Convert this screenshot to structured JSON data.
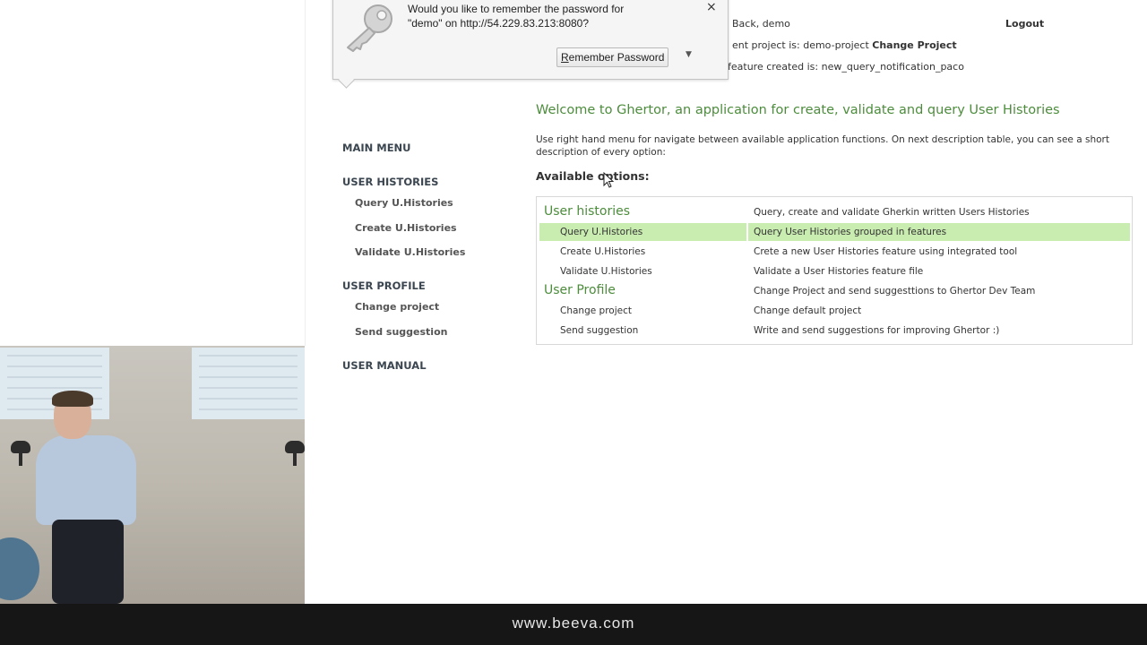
{
  "header": {
    "welcome_back": "Back, demo",
    "project_prefix": "ent project is: demo-project",
    "change_project": "Change Project",
    "feature_created": "feature created is: new_query_notification_paco",
    "logout": "Logout"
  },
  "sidebar": {
    "main_menu": "MAIN MENU",
    "user_histories": "USER HISTORIES",
    "query": "Query U.Histories",
    "create": "Create U.Histories",
    "validate": "Validate U.Histories",
    "user_profile": "USER PROFILE",
    "change_project": "Change project",
    "send_suggestion": "Send suggestion",
    "user_manual": "USER MANUAL"
  },
  "main": {
    "welcome": "Welcome to Ghertor, an application for create, validate and query User Histories",
    "description": "Use right hand menu for navigate between available application functions. On next description table, you can see a short description of every option:",
    "available_options": "Available options:"
  },
  "options": [
    {
      "label": "User histories",
      "description": "Query, create and validate Gherkin written Users Histories",
      "type": "section"
    },
    {
      "label": "Query U.Histories",
      "description": "Query User Histories grouped in features",
      "type": "sub",
      "highlighted": true
    },
    {
      "label": "Create U.Histories",
      "description": "Crete a new User Histories feature using integrated tool",
      "type": "sub"
    },
    {
      "label": "Validate U.Histories",
      "description": "Validate a User Histories feature file",
      "type": "sub"
    },
    {
      "label": "User Profile",
      "description": "Change Project and send suggesttions to Ghertor Dev Team",
      "type": "section"
    },
    {
      "label": "Change project",
      "description": "Change default project",
      "type": "sub"
    },
    {
      "label": "Send suggestion",
      "description": "Write and send suggestions for improving Ghertor :)",
      "type": "sub"
    }
  ],
  "popup": {
    "question_line1": "Would you like to remember the password for",
    "question_line2": "\"demo\" on http://54.229.83.213:8080?",
    "close_glyph": "×",
    "remember_first_letter": "R",
    "remember_rest": "emember Password",
    "dropdown_glyph": "▼"
  },
  "footer": {
    "url": "www.beeva.com"
  },
  "colors": {
    "accent_green": "#4c8c3c",
    "highlight_green": "#c9ecb0",
    "footer_bg": "#161616"
  }
}
